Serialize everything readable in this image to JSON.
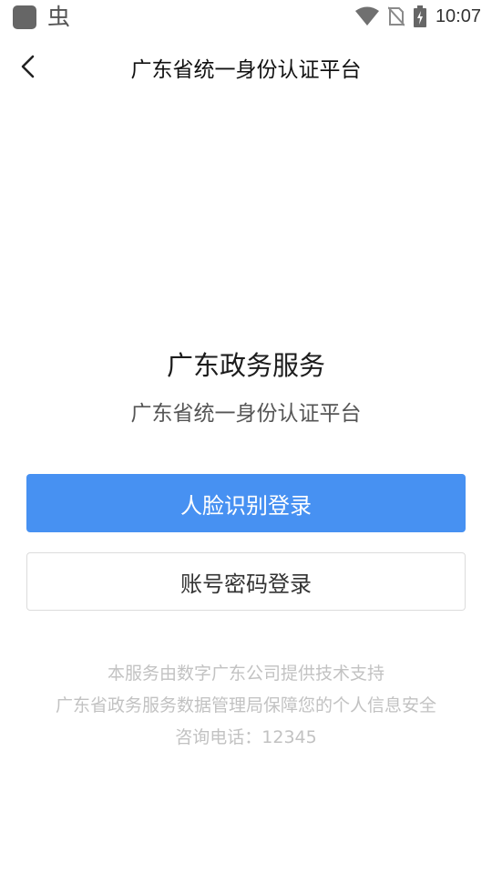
{
  "status_bar": {
    "time": "10:07",
    "left_icons": [
      "app-icon",
      "bug-icon"
    ],
    "right_icons": [
      "wifi-icon",
      "no-sim-icon",
      "battery-charging-icon"
    ]
  },
  "header": {
    "title": "广东省统一身份认证平台",
    "back_icon": "chevron-left-icon"
  },
  "brand": {
    "title": "广东政务服务",
    "subtitle": "广东省统一身份认证平台"
  },
  "actions": {
    "face_login": "人脸识别登录",
    "password_login": "账号密码登录"
  },
  "footer": {
    "line1": "本服务由数字广东公司提供技术支持",
    "line2": "广东省政务服务数据管理局保障您的个人信息安全",
    "line3": "咨询电话：12345"
  },
  "colors": {
    "primary": "#4791f2",
    "footer_text": "#c2c2c2"
  }
}
